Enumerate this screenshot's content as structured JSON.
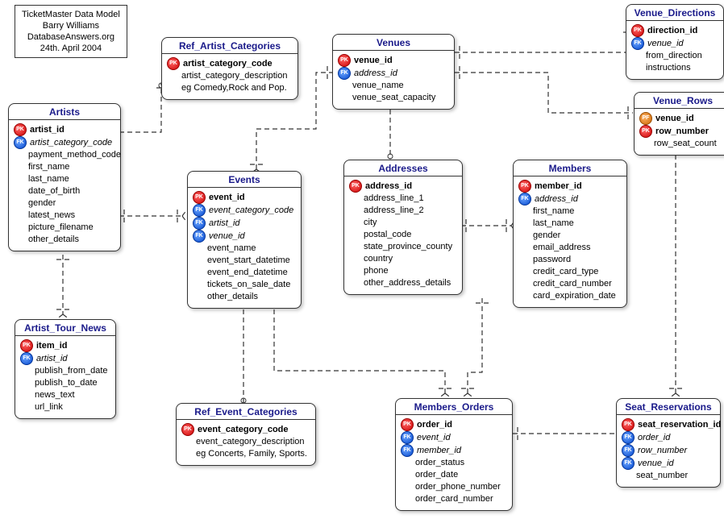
{
  "info": {
    "line1": "TicketMaster Data Model",
    "line2": "Barry Williams",
    "line3": "DatabaseAnswers.org",
    "line4": "24th. April 2004"
  },
  "entities": {
    "artists": {
      "title": "Artists",
      "attrs": [
        {
          "key": "pk",
          "text": "artist_id"
        },
        {
          "key": "fk",
          "text": "artist_category_code"
        },
        {
          "key": "",
          "text": "payment_method_code"
        },
        {
          "key": "",
          "text": "first_name"
        },
        {
          "key": "",
          "text": "last_name"
        },
        {
          "key": "",
          "text": "date_of_birth"
        },
        {
          "key": "",
          "text": "gender"
        },
        {
          "key": "",
          "text": "latest_news"
        },
        {
          "key": "",
          "text": "picture_filename"
        },
        {
          "key": "",
          "text": "other_details"
        }
      ]
    },
    "artist_tour_news": {
      "title": "Artist_Tour_News",
      "attrs": [
        {
          "key": "pk",
          "text": "item_id"
        },
        {
          "key": "fk",
          "text": "artist_id"
        },
        {
          "key": "",
          "text": "publish_from_date"
        },
        {
          "key": "",
          "text": "publish_to_date"
        },
        {
          "key": "",
          "text": "news_text"
        },
        {
          "key": "",
          "text": "url_link"
        }
      ]
    },
    "ref_artist_categories": {
      "title": "Ref_Artist_Categories",
      "attrs": [
        {
          "key": "pk",
          "text": "artist_category_code"
        },
        {
          "key": "",
          "text": "artist_category_description"
        },
        {
          "key": "",
          "text": "eg Comedy,Rock and Pop."
        }
      ]
    },
    "events": {
      "title": "Events",
      "attrs": [
        {
          "key": "pk",
          "text": "event_id"
        },
        {
          "key": "fk",
          "text": "event_category_code"
        },
        {
          "key": "fk",
          "text": "artist_id"
        },
        {
          "key": "fk",
          "text": "venue_id"
        },
        {
          "key": "",
          "text": "event_name"
        },
        {
          "key": "",
          "text": "event_start_datetime"
        },
        {
          "key": "",
          "text": "event_end_datetime"
        },
        {
          "key": "",
          "text": "tickets_on_sale_date"
        },
        {
          "key": "",
          "text": "other_details"
        }
      ]
    },
    "ref_event_categories": {
      "title": "Ref_Event_Categories",
      "attrs": [
        {
          "key": "pk",
          "text": "event_category_code"
        },
        {
          "key": "",
          "text": "event_category_description"
        },
        {
          "key": "",
          "text": "eg Concerts, Family, Sports."
        }
      ]
    },
    "venues": {
      "title": "Venues",
      "attrs": [
        {
          "key": "pk",
          "text": "venue_id"
        },
        {
          "key": "fk",
          "text": "address_id"
        },
        {
          "key": "",
          "text": "venue_name"
        },
        {
          "key": "",
          "text": "venue_seat_capacity"
        }
      ]
    },
    "addresses": {
      "title": "Addresses",
      "attrs": [
        {
          "key": "pk",
          "text": "address_id"
        },
        {
          "key": "",
          "text": "address_line_1"
        },
        {
          "key": "",
          "text": "address_line_2"
        },
        {
          "key": "",
          "text": "city"
        },
        {
          "key": "",
          "text": "postal_code"
        },
        {
          "key": "",
          "text": "state_province_county"
        },
        {
          "key": "",
          "text": "country"
        },
        {
          "key": "",
          "text": "phone"
        },
        {
          "key": "",
          "text": "other_address_details"
        }
      ]
    },
    "members": {
      "title": "Members",
      "attrs": [
        {
          "key": "pk",
          "text": "member_id"
        },
        {
          "key": "fk",
          "text": "address_id"
        },
        {
          "key": "",
          "text": "first_name"
        },
        {
          "key": "",
          "text": "last_name"
        },
        {
          "key": "",
          "text": "gender"
        },
        {
          "key": "",
          "text": "email_address"
        },
        {
          "key": "",
          "text": "password"
        },
        {
          "key": "",
          "text": "credit_card_type"
        },
        {
          "key": "",
          "text": "credit_card_number"
        },
        {
          "key": "",
          "text": "card_expiration_date"
        }
      ]
    },
    "members_orders": {
      "title": "Members_Orders",
      "attrs": [
        {
          "key": "pk",
          "text": "order_id"
        },
        {
          "key": "fk",
          "text": "event_id"
        },
        {
          "key": "fk",
          "text": "member_id"
        },
        {
          "key": "",
          "text": "order_status"
        },
        {
          "key": "",
          "text": "order_date"
        },
        {
          "key": "",
          "text": "order_phone_number"
        },
        {
          "key": "",
          "text": "order_card_number"
        }
      ]
    },
    "venue_directions": {
      "title": "Venue_Directions",
      "attrs": [
        {
          "key": "pk",
          "text": "direction_id"
        },
        {
          "key": "fk",
          "text": "venue_id"
        },
        {
          "key": "",
          "text": "from_direction"
        },
        {
          "key": "",
          "text": "instructions"
        }
      ]
    },
    "venue_rows": {
      "title": "Venue_Rows",
      "attrs": [
        {
          "key": "pf",
          "text": "venue_id"
        },
        {
          "key": "pk",
          "text": "row_number"
        },
        {
          "key": "",
          "text": "row_seat_count"
        }
      ]
    },
    "seat_reservations": {
      "title": "Seat_Reservations",
      "attrs": [
        {
          "key": "pk",
          "text": "seat_reservation_id"
        },
        {
          "key": "fk",
          "text": "order_id"
        },
        {
          "key": "fk",
          "text": "row_number"
        },
        {
          "key": "fk",
          "text": "venue_id"
        },
        {
          "key": "",
          "text": "seat_number"
        }
      ]
    }
  }
}
